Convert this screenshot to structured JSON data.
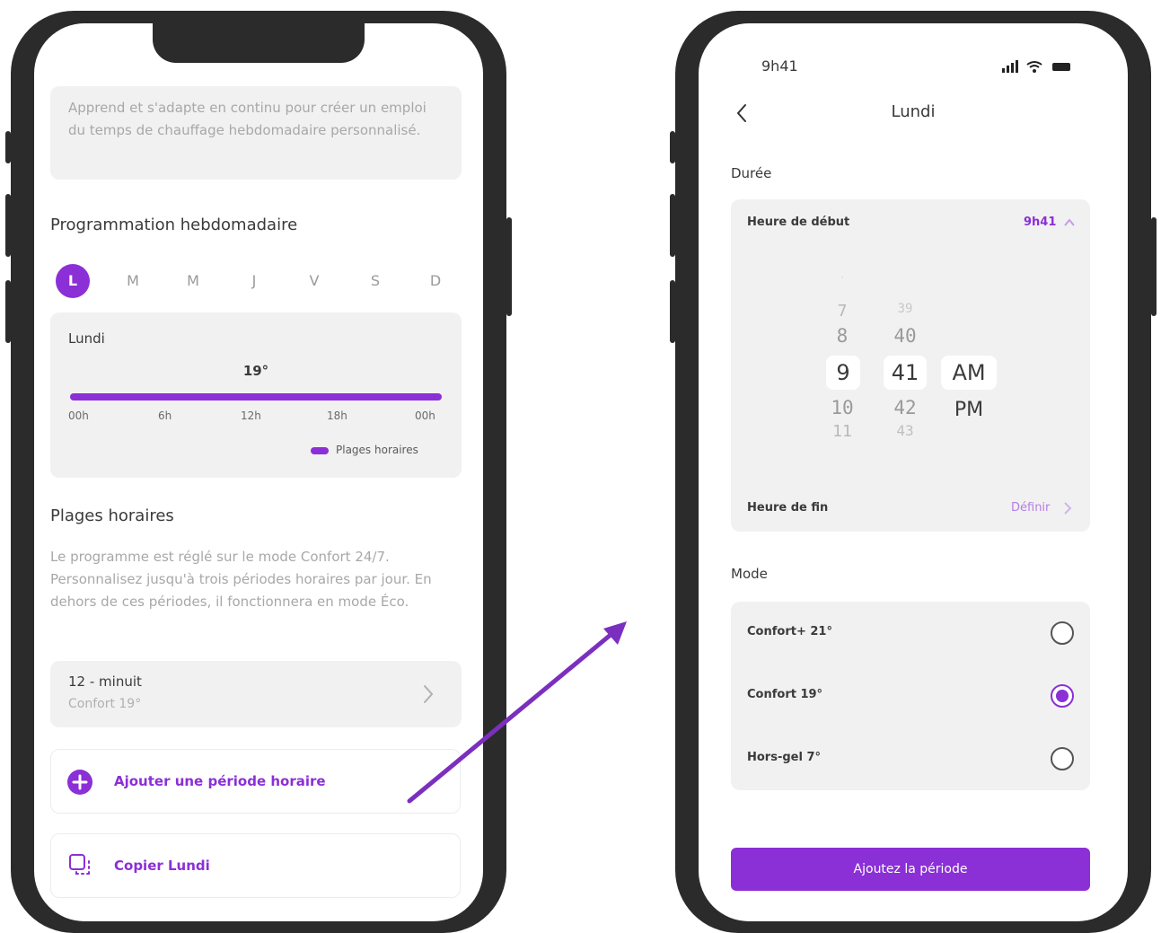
{
  "screen1": {
    "intro_text": "Apprend et s'adapte en continu pour créer un emploi du temps de chauffage hebdomadaire personnalisé.",
    "weekly_title": "Programmation hebdomadaire",
    "days": [
      "L",
      "M",
      "M",
      "J",
      "V",
      "S",
      "D"
    ],
    "selected_day_index": 0,
    "schedule": {
      "day_label": "Lundi",
      "temperature": "19°",
      "ticks": [
        "00h",
        "6h",
        "12h",
        "18h",
        "00h"
      ],
      "legend_label": "Plages horaires"
    },
    "slots_title": "Plages horaires",
    "slots_description": "Le programme est réglé sur le mode Confort 24/7. Personnalisez jusqu'à trois périodes horaires par jour. En dehors de ces périodes, il fonctionnera en mode Éco.",
    "slot": {
      "time": "12 - minuit",
      "mode": "Confort 19°"
    },
    "add_label": "Ajouter une période horaire",
    "copy_label": "Copier Lundi",
    "accent_color": "#8b2fd6"
  },
  "screen2": {
    "status_time": "9h41",
    "title": "Lundi",
    "section_duration": "Durée",
    "start_label": "Heure de début",
    "start_value": "9h41",
    "picker": {
      "hours_above": [
        "7",
        "8"
      ],
      "hour_selected": "9",
      "hours_below": [
        "10",
        "11"
      ],
      "minutes_above": [
        "39",
        "40"
      ],
      "minute_selected": "41",
      "minutes_below": [
        "42",
        "43"
      ],
      "ampm_selected": "AM",
      "ampm_other": "PM"
    },
    "end_label": "Heure de fin",
    "end_value": "Définir",
    "section_mode": "Mode",
    "modes": [
      {
        "label": "Confort+ 21°",
        "selected": false
      },
      {
        "label": "Confort 19°",
        "selected": true
      },
      {
        "label": "Hors-gel 7°",
        "selected": false
      }
    ],
    "cta_label": "Ajoutez la période"
  }
}
